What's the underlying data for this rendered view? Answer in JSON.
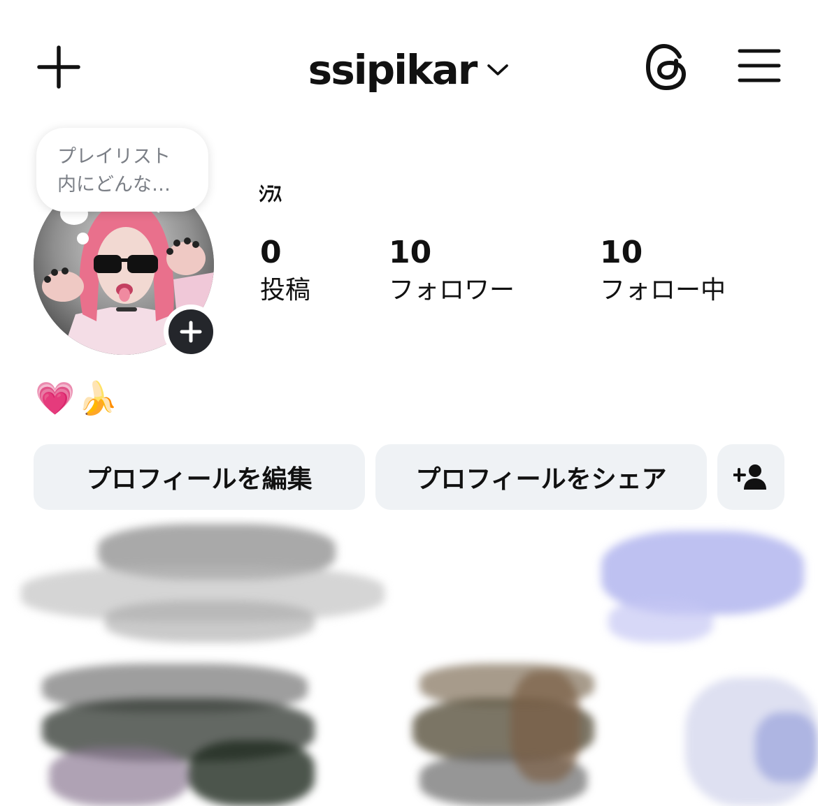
{
  "header": {
    "username": "ssipikar",
    "new_post_icon": "plus-icon",
    "account_switcher_icon": "chevron-down-icon",
    "threads_icon": "threads-icon",
    "menu_icon": "hamburger-menu-icon"
  },
  "note": {
    "line1": "プレイリスト",
    "line2": "内にどんな…"
  },
  "profile": {
    "display_name": "ｼﾗｽ",
    "bio": "💗🍌",
    "add_story_icon": "plus-icon"
  },
  "stats": [
    {
      "count": "0",
      "label": "投稿"
    },
    {
      "count": "10",
      "label": "フォロワー"
    },
    {
      "count": "10",
      "label": "フォロー中"
    }
  ],
  "buttons": {
    "edit_profile": "プロフィールを編集",
    "share_profile": "プロフィールをシェア",
    "discover_people_icon": "add-person-icon"
  },
  "colors": {
    "button_bg": "#eff2f5",
    "text": "#111111",
    "note_text": "#7b7f86",
    "add_story_bg": "#24262b"
  }
}
